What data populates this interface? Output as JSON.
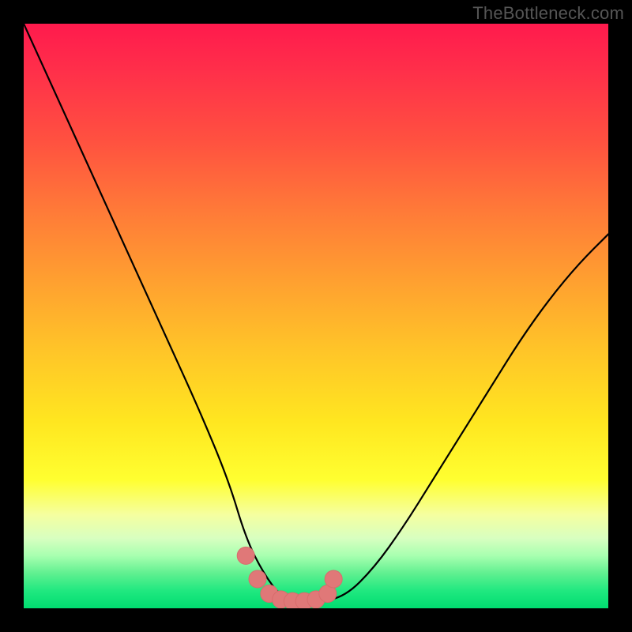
{
  "watermark": {
    "text": "TheBottleneck.com"
  },
  "colors": {
    "curve_stroke": "#000000",
    "marker_fill": "#e07878",
    "marker_stroke": "#d86c6c"
  },
  "chart_data": {
    "type": "line",
    "title": "",
    "xlabel": "",
    "ylabel": "",
    "xlim": [
      0,
      100
    ],
    "ylim": [
      0,
      100
    ],
    "series": [
      {
        "name": "bottleneck-curve",
        "x": [
          0,
          5,
          10,
          15,
          20,
          25,
          30,
          35,
          38,
          41,
          44,
          47,
          50,
          55,
          60,
          65,
          70,
          75,
          80,
          85,
          90,
          95,
          100
        ],
        "y": [
          100,
          89,
          78,
          67,
          56,
          45,
          34,
          22,
          12,
          6,
          2,
          1,
          1,
          2,
          7,
          14,
          22,
          30,
          38,
          46,
          53,
          59,
          64
        ]
      }
    ],
    "markers": {
      "name": "highlighted-points",
      "x": [
        38,
        40,
        42,
        44,
        46,
        48,
        50,
        52,
        53
      ],
      "y": [
        9,
        5,
        2.5,
        1.5,
        1.2,
        1.2,
        1.5,
        2.5,
        5
      ]
    }
  }
}
